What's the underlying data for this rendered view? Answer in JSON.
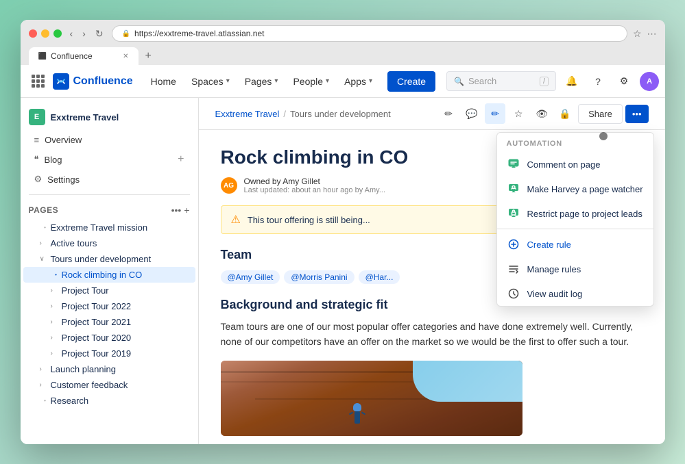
{
  "browser": {
    "tab_title": "Confluence",
    "tab_favicon": "●",
    "address": "https://exxtreme-travel.atlassian.net",
    "new_tab_icon": "+",
    "back_icon": "‹",
    "forward_icon": "›",
    "refresh_icon": "↻",
    "star_icon": "☆",
    "more_icon": "⋯"
  },
  "nav": {
    "home": "Home",
    "spaces": "Spaces",
    "spaces_chevron": "▾",
    "pages": "Pages",
    "pages_chevron": "▾",
    "people": "People",
    "people_chevron": "▾",
    "apps": "Apps",
    "apps_chevron": "▾",
    "create": "Create",
    "search_placeholder": "Search",
    "search_shortcut": "/",
    "logo_text": "Confluence",
    "logo_letter": "C"
  },
  "sidebar": {
    "space_name": "Exxtreme Travel",
    "space_letter": "E",
    "items": [
      {
        "label": "Overview",
        "icon": "≡"
      },
      {
        "label": "Blog",
        "icon": "❝"
      }
    ],
    "settings_label": "Settings",
    "pages_section": "Pages",
    "pages_icon": "📄",
    "tree": [
      {
        "label": "Exxtreme Travel mission",
        "indent": 1,
        "type": "bullet",
        "expanded": false
      },
      {
        "label": "Active tours",
        "indent": 1,
        "type": "expand",
        "expanded": false
      },
      {
        "label": "Tours under development",
        "indent": 1,
        "type": "expand",
        "expanded": true
      },
      {
        "label": "Rock climbing in CO",
        "indent": 2,
        "type": "bullet",
        "active": true
      },
      {
        "label": "Project Tour",
        "indent": 2,
        "type": "expand",
        "expanded": false
      },
      {
        "label": "Project Tour 2022",
        "indent": 2,
        "type": "expand",
        "expanded": false
      },
      {
        "label": "Project Tour 2021",
        "indent": 2,
        "type": "expand",
        "expanded": false
      },
      {
        "label": "Project Tour 2020",
        "indent": 2,
        "type": "expand",
        "expanded": false
      },
      {
        "label": "Project Tour 2019",
        "indent": 2,
        "type": "expand",
        "expanded": false
      },
      {
        "label": "Launch planning",
        "indent": 1,
        "type": "expand",
        "expanded": false
      },
      {
        "label": "Customer feedback",
        "indent": 1,
        "type": "expand",
        "expanded": false
      },
      {
        "label": "Research",
        "indent": 1,
        "type": "bullet",
        "expanded": false
      }
    ]
  },
  "page": {
    "breadcrumb_space": "Exxtreme Travel",
    "breadcrumb_sep": "/",
    "breadcrumb_parent": "Tours under development",
    "title": "Rock climbing in CO",
    "author_initials": "AG",
    "owned_by": "Owned by Amy Gillet",
    "last_updated": "Last updated: about an hour ago by Amy...",
    "warning_text": "This tour offering is still being...",
    "section_team": "Team",
    "team_tags": [
      "@Amy Gillet",
      "@Morris Panini",
      "@Har..."
    ],
    "section_background": "Background and strategic fit",
    "body_text": "Team tours are one of our most popular offer categories and have done extremely well. Currently, none of our competitors have an offer on the market so we would be the first to offer such a tour."
  },
  "page_actions": {
    "edit_icon": "✏",
    "comment_icon": "💬",
    "highlight_icon": "✏",
    "star_icon": "☆",
    "watch_icon": "👁",
    "restrict_icon": "🔒",
    "share_label": "Share",
    "more_label": "•••"
  },
  "automation": {
    "header": "AUTOMATION",
    "items": [
      {
        "label": "Comment on page",
        "icon": "🤖"
      },
      {
        "label": "Make Harvey a page watcher",
        "icon": "🤖"
      },
      {
        "label": "Restrict page to project leads",
        "icon": "🤖"
      }
    ],
    "create_rule": "Create rule",
    "manage_rules": "Manage rules",
    "view_audit_log": "View audit log"
  }
}
